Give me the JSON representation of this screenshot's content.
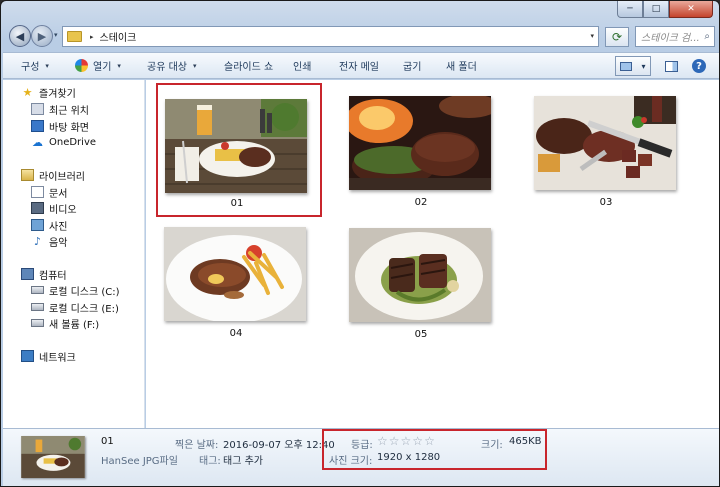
{
  "window": {
    "caption_buttons": {
      "minimize": "─",
      "maximize": "□",
      "close": "✕"
    }
  },
  "address": {
    "path": "스테이크",
    "separator": "▸",
    "dropdown": "▾",
    "refresh_glyph": "⟳",
    "search_placeholder": "스테이크 검...",
    "search_icon": "search-icon"
  },
  "commands": {
    "organize": "구성",
    "open": "열기",
    "share": "공유 대상",
    "slideshow": "슬라이드 쇼",
    "print": "인쇄",
    "email": "전자 메일",
    "burn": "굽기",
    "new_folder": "새 폴더",
    "chevron": "▾",
    "help": "?"
  },
  "nav": {
    "favorites": "즐겨찾기",
    "recent": "최근 위치",
    "desktop": "바탕 화면",
    "onedrive": "OneDrive",
    "libraries": "라이브러리",
    "documents": "문서",
    "videos": "비디오",
    "pictures": "사진",
    "music": "음악",
    "computer": "컴퓨터",
    "disk_c": "로컬 디스크 (C:)",
    "disk_e": "로컬 디스크 (E:)",
    "volume_f": "새 볼륨 (F:)",
    "network": "네트워크",
    "star_glyph": "★",
    "cloud_glyph": "☁",
    "music_glyph": "♪"
  },
  "items": [
    {
      "label": "01",
      "selected": true
    },
    {
      "label": "02",
      "selected": false
    },
    {
      "label": "03",
      "selected": false
    },
    {
      "label": "04",
      "selected": false
    },
    {
      "label": "05",
      "selected": false
    }
  ],
  "details": {
    "name": "01",
    "type": "HanSee JPG파일",
    "date_label": "찍은 날짜:",
    "date_value": "2016-09-07 오후 12:40",
    "tags_label": "태그:",
    "tags_value": "태그 추가",
    "rating_label": "등급:",
    "rating": 0,
    "rating_max": 5,
    "star_glyph": "☆",
    "dim_label": "사진 크기:",
    "dim_value": "1920 x 1280",
    "size_label": "크기:",
    "size_value": "465KB"
  },
  "colors": {
    "highlight": "#c8252c",
    "accent": "#1e395b"
  }
}
